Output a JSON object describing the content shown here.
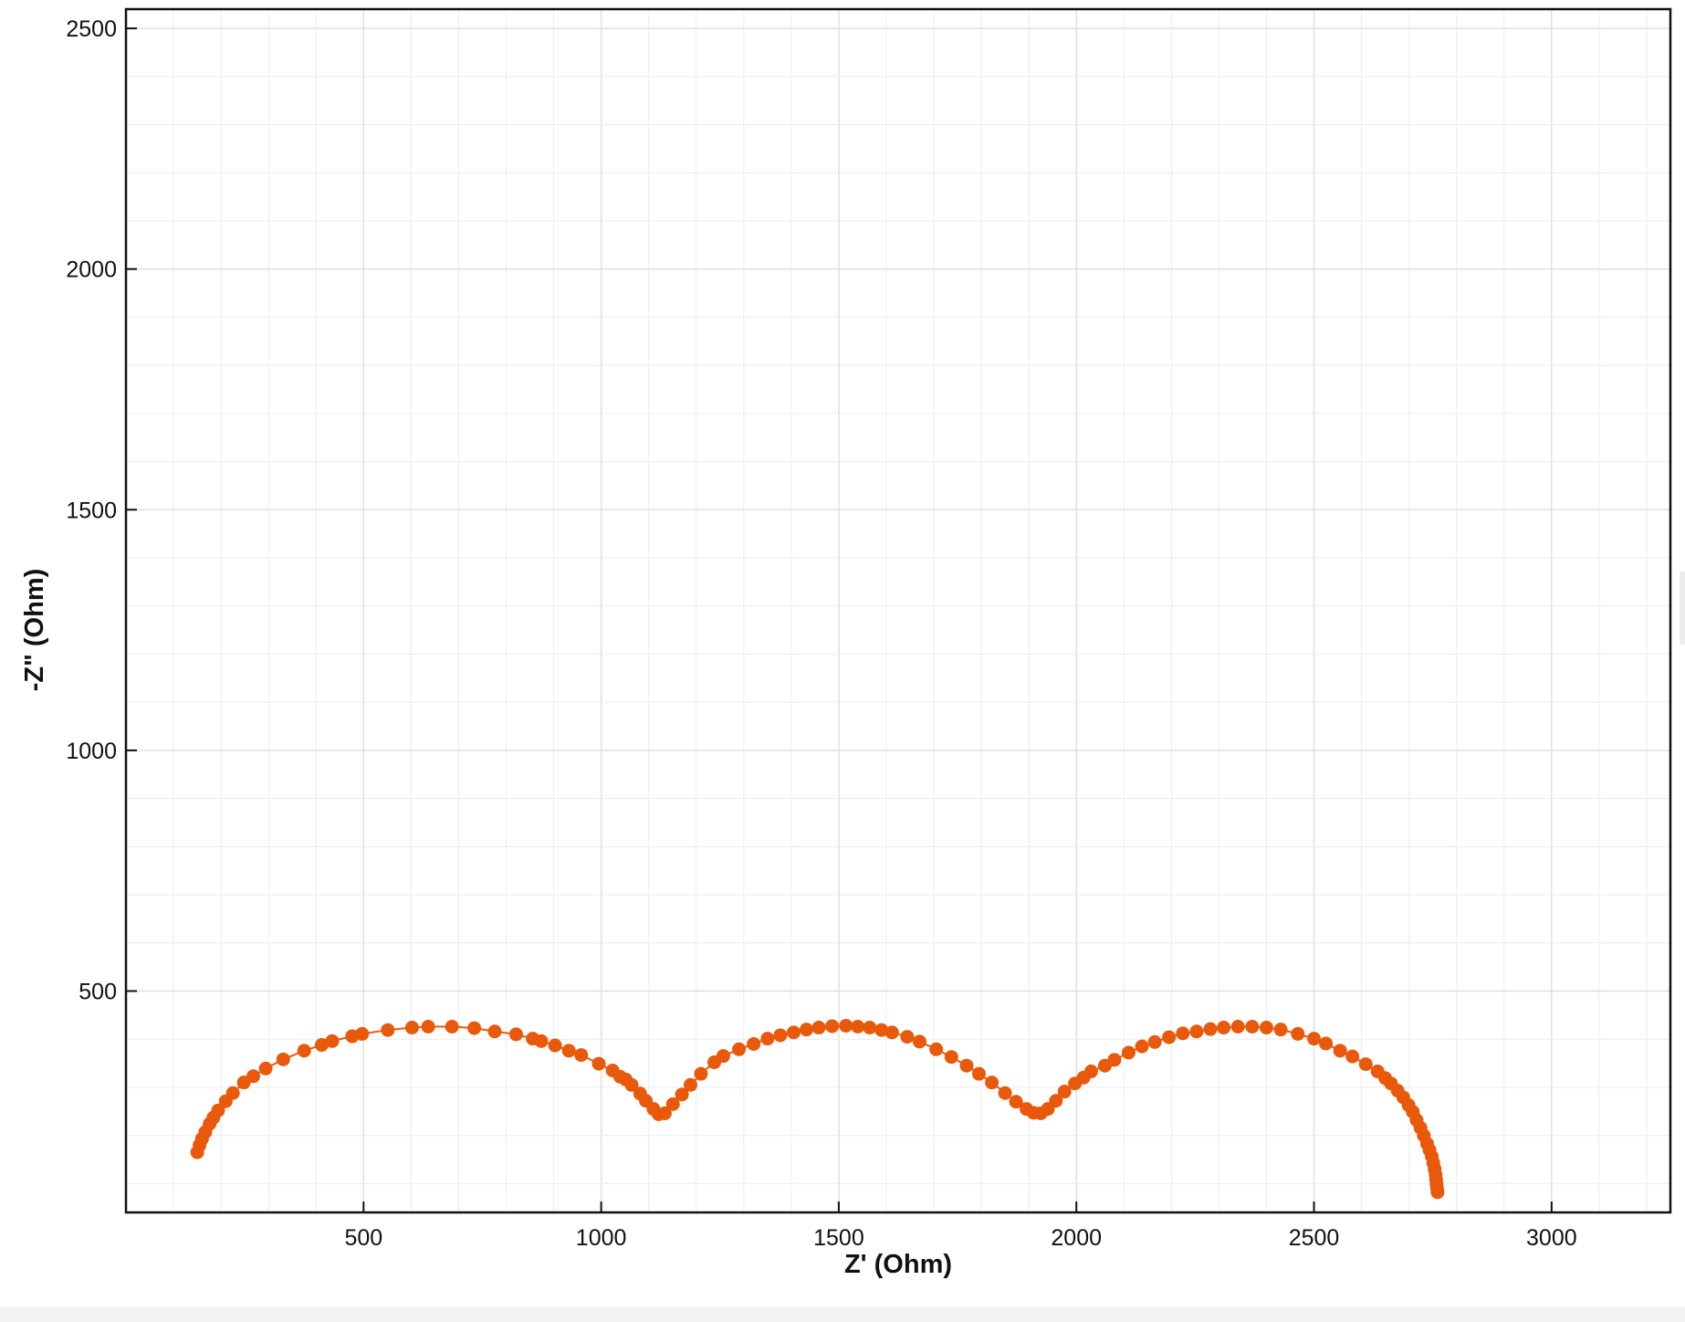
{
  "chart_data": {
    "type": "scatter",
    "title": "",
    "xlabel": "Z' (Ohm)",
    "ylabel": "-Z\" (Ohm)",
    "xlim": [
      0,
      3250
    ],
    "ylim": [
      40,
      2540
    ],
    "xticks": [
      500,
      1000,
      1500,
      2000,
      2500,
      3000
    ],
    "yticks": [
      500,
      1000,
      1500,
      2000,
      2500
    ],
    "grid": true,
    "legend": "none",
    "marker_color": "#e8590c",
    "line_color": "#e8590c",
    "series": [
      {
        "points": [
          [
            150,
            165
          ],
          [
            155,
            180
          ],
          [
            160,
            193
          ],
          [
            167,
            207
          ],
          [
            176,
            224
          ],
          [
            184,
            237
          ],
          [
            194,
            252
          ],
          [
            210,
            271
          ],
          [
            225,
            288
          ],
          [
            248,
            310
          ],
          [
            268,
            323
          ],
          [
            294,
            339
          ],
          [
            331,
            358
          ],
          [
            375,
            376
          ],
          [
            412,
            388
          ],
          [
            434,
            396
          ],
          [
            476,
            406
          ],
          [
            497,
            411
          ],
          [
            551,
            419
          ],
          [
            602,
            424
          ],
          [
            636,
            426
          ],
          [
            686,
            426
          ],
          [
            733,
            423
          ],
          [
            776,
            416
          ],
          [
            821,
            410
          ],
          [
            856,
            401
          ],
          [
            874,
            396
          ],
          [
            903,
            387
          ],
          [
            932,
            376
          ],
          [
            958,
            367
          ],
          [
            995,
            349
          ],
          [
            1024,
            335
          ],
          [
            1040,
            322
          ],
          [
            1052,
            316
          ],
          [
            1064,
            305
          ],
          [
            1082,
            287
          ],
          [
            1094,
            272
          ],
          [
            1110,
            255
          ],
          [
            1121,
            244
          ],
          [
            1134,
            246
          ],
          [
            1151,
            265
          ],
          [
            1170,
            285
          ],
          [
            1188,
            305
          ],
          [
            1210,
            328
          ],
          [
            1238,
            352
          ],
          [
            1257,
            365
          ],
          [
            1290,
            379
          ],
          [
            1321,
            390
          ],
          [
            1350,
            401
          ],
          [
            1377,
            408
          ],
          [
            1405,
            414
          ],
          [
            1432,
            420
          ],
          [
            1458,
            424
          ],
          [
            1486,
            427
          ],
          [
            1515,
            428
          ],
          [
            1540,
            426
          ],
          [
            1565,
            424
          ],
          [
            1590,
            419
          ],
          [
            1612,
            414
          ],
          [
            1644,
            405
          ],
          [
            1670,
            395
          ],
          [
            1705,
            379
          ],
          [
            1737,
            363
          ],
          [
            1769,
            345
          ],
          [
            1795,
            328
          ],
          [
            1822,
            310
          ],
          [
            1850,
            288
          ],
          [
            1873,
            270
          ],
          [
            1895,
            255
          ],
          [
            1910,
            247
          ],
          [
            1925,
            246
          ],
          [
            1940,
            255
          ],
          [
            1957,
            272
          ],
          [
            1975,
            291
          ],
          [
            1997,
            308
          ],
          [
            2015,
            320
          ],
          [
            2031,
            333
          ],
          [
            2060,
            345
          ],
          [
            2080,
            357
          ],
          [
            2110,
            372
          ],
          [
            2138,
            385
          ],
          [
            2165,
            394
          ],
          [
            2195,
            404
          ],
          [
            2224,
            412
          ],
          [
            2253,
            416
          ],
          [
            2282,
            421
          ],
          [
            2310,
            424
          ],
          [
            2340,
            426
          ],
          [
            2370,
            426
          ],
          [
            2400,
            424
          ],
          [
            2430,
            420
          ],
          [
            2466,
            411
          ],
          [
            2500,
            401
          ],
          [
            2525,
            391
          ],
          [
            2555,
            376
          ],
          [
            2581,
            364
          ],
          [
            2609,
            348
          ],
          [
            2634,
            333
          ],
          [
            2650,
            319
          ],
          [
            2662,
            308
          ],
          [
            2676,
            293
          ],
          [
            2688,
            279
          ],
          [
            2699,
            263
          ],
          [
            2708,
            249
          ],
          [
            2716,
            232
          ],
          [
            2724,
            216
          ],
          [
            2731,
            200
          ],
          [
            2738,
            183
          ],
          [
            2743,
            170
          ],
          [
            2748,
            156
          ],
          [
            2751,
            143
          ],
          [
            2754,
            130
          ],
          [
            2756,
            118
          ],
          [
            2757,
            108
          ],
          [
            2758,
            98
          ],
          [
            2759,
            89
          ],
          [
            2760,
            82
          ]
        ]
      }
    ]
  }
}
